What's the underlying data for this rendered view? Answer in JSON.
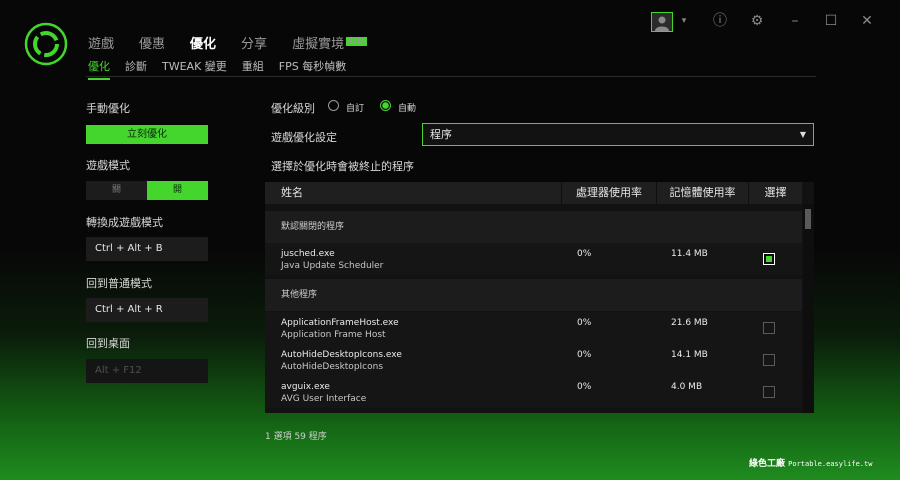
{
  "nav": {
    "tabs": [
      "遊戲",
      "優惠",
      "優化",
      "分享",
      "虛擬實境"
    ],
    "active_tab": "優化",
    "beta_badge": "BETA"
  },
  "subnav": {
    "tabs": [
      "優化",
      "診斷",
      "TWEAK 變更",
      "重組",
      "FPS 每秒幀數"
    ],
    "active_tab": "優化"
  },
  "window_controls": {
    "avatar_caret": "▾",
    "info": "ⓘ",
    "settings": "⚙",
    "minimize": "–",
    "maximize": "☐",
    "close": "✕"
  },
  "left_panel": {
    "manual_title": "手動優化",
    "optimize_now_button": "立刻優化",
    "game_mode_title": "遊戲模式",
    "game_mode_off": "關",
    "game_mode_on": "開",
    "switch_title": "轉換成遊戲模式",
    "switch_hotkey": "Ctrl + Alt + B",
    "normal_title": "回到普通模式",
    "normal_hotkey": "Ctrl + Alt + R",
    "desktop_title": "回到桌面",
    "desktop_hotkey": "Alt + F12"
  },
  "right_panel": {
    "level_label": "優化級別",
    "level_custom": "自訂",
    "level_auto": "自動",
    "level_selected": "自動",
    "game_settings_label": "遊戲優化設定",
    "dropdown_value": "程序",
    "section_label": "選擇於優化時會被終止的程序"
  },
  "table": {
    "headers": [
      "姓名",
      "處理器使用率",
      "記憶體使用率",
      "選擇"
    ],
    "group_default": "默認關閉的程序",
    "group_other": "其他程序",
    "default_rows": [
      {
        "name": "jusched.exe",
        "desc": "Java Update Scheduler",
        "cpu": "0%",
        "mem": "11.4 MB",
        "selected": true
      }
    ],
    "other_rows": [
      {
        "name": "ApplicationFrameHost.exe",
        "desc": "Application Frame Host",
        "cpu": "0%",
        "mem": "21.6 MB",
        "selected": false
      },
      {
        "name": "AutoHideDesktopIcons.exe",
        "desc": "AutoHideDesktopIcons",
        "cpu": "0%",
        "mem": "14.1 MB",
        "selected": false
      },
      {
        "name": "avguix.exe",
        "desc": "AVG User Interface",
        "cpu": "0%",
        "mem": "4.0 MB",
        "selected": false
      }
    ]
  },
  "footer": {
    "count_text": "1 選項 59 程序"
  },
  "watermark": {
    "text": "綠色工廠",
    "url": "Portable.easylife.tw"
  },
  "colors": {
    "accent": "#44d62c",
    "background": "#070707"
  }
}
